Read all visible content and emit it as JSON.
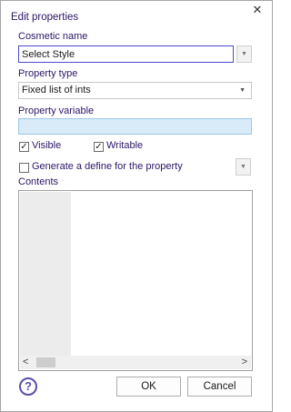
{
  "window": {
    "title": "Edit properties",
    "close_glyph": "✕"
  },
  "cosmetic_name": {
    "label": "Cosmetic name",
    "value": "Select Style"
  },
  "property_type": {
    "label": "Property type",
    "selected": "Fixed list of ints"
  },
  "property_variable": {
    "label": "Property variable",
    "value": ""
  },
  "visible": {
    "label": "Visible",
    "checked": true
  },
  "writable": {
    "label": "Writable",
    "checked": true
  },
  "generate_define": {
    "label": "Generate a define for the property",
    "checked": false
  },
  "contents": {
    "label": "Contents"
  },
  "buttons": {
    "ok": "OK",
    "cancel": "Cancel",
    "help": "?"
  },
  "glyphs": {
    "check": "✓",
    "dropdown": "▼",
    "scroll_left": "<",
    "scroll_right": ">"
  },
  "colors": {
    "accent": "#2b1566",
    "focus_border": "#4a4ad0",
    "text_field_bg": "#d9ebf9",
    "help_icon": "#5a4fa8"
  }
}
